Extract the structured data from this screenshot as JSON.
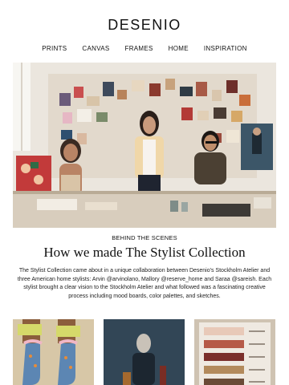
{
  "brand": {
    "logo": "DESENIO"
  },
  "nav": {
    "items": [
      "PRINTS",
      "CANVAS",
      "FRAMES",
      "HOME",
      "INSPIRATION"
    ]
  },
  "hero": {
    "image": "hero-photo-three-stylists-in-studio"
  },
  "article": {
    "kicker": "BEHIND THE SCENES",
    "title": "How we made The Stylist Collection",
    "body": "The Stylist Collection came about in a unique collaboration between Desenio's Stockholm Atelier and three American home stylists: Arvin @arvinolano, Mallory @reserve_home and Saraa @sareish. Each stylist brought a clear vision to the Stockholm Atelier and what followed was a fascinating creative process including mood boards, color palettes, and sketches."
  },
  "products": [
    {
      "image": "print-socks-legs"
    },
    {
      "image": "print-seated-figure"
    },
    {
      "image": "print-color-swatches"
    }
  ],
  "colors": {
    "background": "#ffffff",
    "text": "#111111"
  }
}
